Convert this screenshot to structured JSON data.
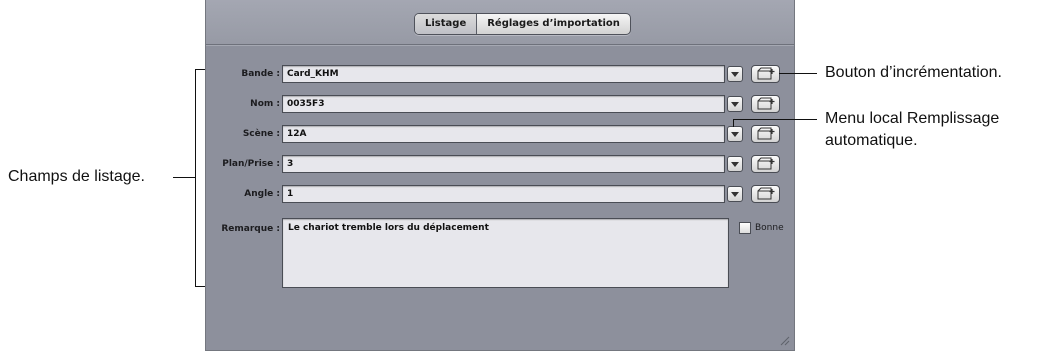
{
  "tabs": [
    {
      "label": "Listage",
      "active": true
    },
    {
      "label": "Réglages d’importation",
      "active": false
    }
  ],
  "fields": [
    {
      "label": "Bande :",
      "value": "Card_KHM"
    },
    {
      "label": "Nom :",
      "value": "0035F3"
    },
    {
      "label": "Scène :",
      "value": "12A"
    },
    {
      "label": "Plan/Prise :",
      "value": "3"
    },
    {
      "label": "Angle :",
      "value": "1"
    }
  ],
  "remark": {
    "label": "Remarque :",
    "value": "Le chariot tremble lors du déplacement"
  },
  "good_checkbox": {
    "label": "Bonne",
    "checked": false
  },
  "callouts": {
    "increment_button": "Bouton d’incrémentation.",
    "autofill_menu_line1": "Menu local Remplissage",
    "autofill_menu_line2": "automatique.",
    "logging_fields": "Champs de listage."
  },
  "colors": {
    "panel": "#8d909c",
    "field": "#e7e7ec"
  }
}
